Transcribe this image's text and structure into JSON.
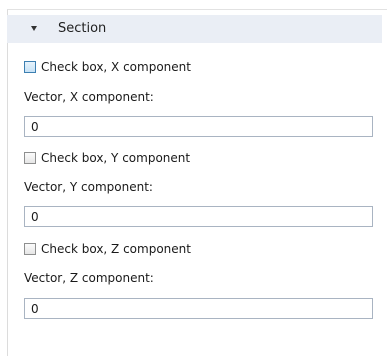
{
  "section": {
    "title": "Section"
  },
  "fields": [
    {
      "checkbox_label": "Check box, X component",
      "checkbox_checked": false,
      "vector_label": "Vector, X component:",
      "value": "0"
    },
    {
      "checkbox_label": "Check box, Y component",
      "checkbox_checked": false,
      "vector_label": "Vector, Y component:",
      "value": "0"
    },
    {
      "checkbox_label": "Check box, Z component",
      "checkbox_checked": false,
      "vector_label": "Vector, Z component:",
      "value": "0"
    }
  ]
}
